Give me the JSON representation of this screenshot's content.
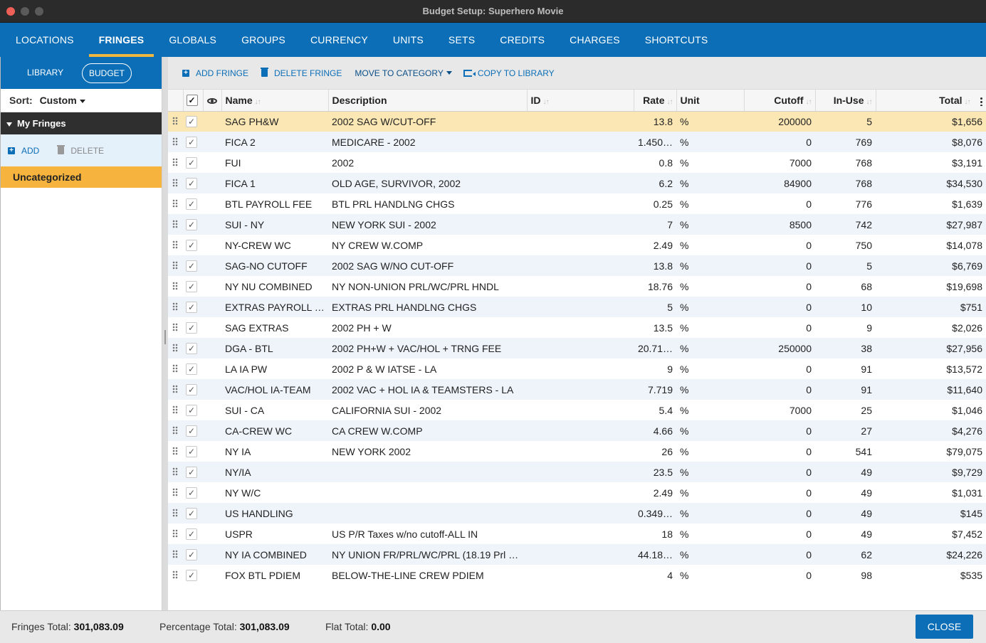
{
  "window": {
    "title": "Budget Setup: Superhero Movie"
  },
  "topnav": {
    "tabs": [
      {
        "label": "LOCATIONS"
      },
      {
        "label": "FRINGES",
        "active": true
      },
      {
        "label": "GLOBALS"
      },
      {
        "label": "GROUPS"
      },
      {
        "label": "CURRENCY"
      },
      {
        "label": "UNITS"
      },
      {
        "label": "SETS"
      },
      {
        "label": "CREDITS"
      },
      {
        "label": "CHARGES"
      },
      {
        "label": "SHORTCUTS"
      }
    ]
  },
  "sidebar": {
    "library_label": "LIBRARY",
    "budget_label": "BUDGET",
    "sort_label": "Sort:",
    "sort_value": "Custom",
    "group_title": "My Fringes",
    "add_label": "ADD",
    "delete_label": "DELETE",
    "category": "Uncategorized"
  },
  "toolbar": {
    "add_fringe": "ADD FRINGE",
    "delete_fringe": "DELETE FRINGE",
    "move_to_category": "MOVE TO CATEGORY",
    "copy_to_library": "COPY TO LIBRARY"
  },
  "table": {
    "headers": {
      "name": "Name",
      "description": "Description",
      "id": "ID",
      "rate": "Rate",
      "unit": "Unit",
      "cutoff": "Cutoff",
      "inuse": "In-Use",
      "total": "Total"
    },
    "rows": [
      {
        "name": "SAG PH&W",
        "description": "2002 SAG W/CUT-OFF",
        "id": "",
        "rate": "13.8",
        "unit": "%",
        "cutoff": "200000",
        "inuse": "5",
        "total": "$1,656"
      },
      {
        "name": "FICA 2",
        "description": "MEDICARE - 2002",
        "id": "",
        "rate": "1.450…",
        "unit": "%",
        "cutoff": "0",
        "inuse": "769",
        "total": "$8,076"
      },
      {
        "name": "FUI",
        "description": "2002",
        "id": "",
        "rate": "0.8",
        "unit": "%",
        "cutoff": "7000",
        "inuse": "768",
        "total": "$3,191"
      },
      {
        "name": "FICA 1",
        "description": "OLD AGE, SURVIVOR, 2002",
        "id": "",
        "rate": "6.2",
        "unit": "%",
        "cutoff": "84900",
        "inuse": "768",
        "total": "$34,530"
      },
      {
        "name": "BTL PAYROLL FEE",
        "description": "BTL PRL HANDLNG CHGS",
        "id": "",
        "rate": "0.25",
        "unit": "%",
        "cutoff": "0",
        "inuse": "776",
        "total": "$1,639"
      },
      {
        "name": "SUI - NY",
        "description": "NEW YORK SUI - 2002",
        "id": "",
        "rate": "7",
        "unit": "%",
        "cutoff": "8500",
        "inuse": "742",
        "total": "$27,987"
      },
      {
        "name": "NY-CREW WC",
        "description": "NY CREW W.COMP",
        "id": "",
        "rate": "2.49",
        "unit": "%",
        "cutoff": "0",
        "inuse": "750",
        "total": "$14,078"
      },
      {
        "name": "SAG-NO CUTOFF",
        "description": "2002 SAG W/NO CUT-OFF",
        "id": "",
        "rate": "13.8",
        "unit": "%",
        "cutoff": "0",
        "inuse": "5",
        "total": "$6,769"
      },
      {
        "name": "NY NU COMBINED",
        "description": "NY NON-UNION PRL/WC/PRL HNDL",
        "id": "",
        "rate": "18.76",
        "unit": "%",
        "cutoff": "0",
        "inuse": "68",
        "total": "$19,698"
      },
      {
        "name": "EXTRAS PAYROLL …",
        "description": "EXTRAS PRL HANDLNG CHGS",
        "id": "",
        "rate": "5",
        "unit": "%",
        "cutoff": "0",
        "inuse": "10",
        "total": "$751"
      },
      {
        "name": "SAG EXTRAS",
        "description": "2002 PH + W",
        "id": "",
        "rate": "13.5",
        "unit": "%",
        "cutoff": "0",
        "inuse": "9",
        "total": "$2,026"
      },
      {
        "name": "DGA - BTL",
        "description": "2002 PH+W + VAC/HOL + TRNG FEE",
        "id": "",
        "rate": "20.71…",
        "unit": "%",
        "cutoff": "250000",
        "inuse": "38",
        "total": "$27,956"
      },
      {
        "name": "LA IA PW",
        "description": "2002 P & W IATSE - LA",
        "id": "",
        "rate": "9",
        "unit": "%",
        "cutoff": "0",
        "inuse": "91",
        "total": "$13,572"
      },
      {
        "name": "VAC/HOL IA-TEAM",
        "description": "2002 VAC + HOL IA & TEAMSTERS - LA",
        "id": "",
        "rate": "7.719",
        "unit": "%",
        "cutoff": "0",
        "inuse": "91",
        "total": "$11,640"
      },
      {
        "name": "SUI - CA",
        "description": "CALIFORNIA SUI - 2002",
        "id": "",
        "rate": "5.4",
        "unit": "%",
        "cutoff": "7000",
        "inuse": "25",
        "total": "$1,046"
      },
      {
        "name": "CA-CREW WC",
        "description": "CA CREW W.COMP",
        "id": "",
        "rate": "4.66",
        "unit": "%",
        "cutoff": "0",
        "inuse": "27",
        "total": "$4,276"
      },
      {
        "name": "NY IA",
        "description": "NEW YORK 2002",
        "id": "",
        "rate": "26",
        "unit": "%",
        "cutoff": "0",
        "inuse": "541",
        "total": "$79,075"
      },
      {
        "name": "NY/IA",
        "description": "",
        "id": "",
        "rate": "23.5",
        "unit": "%",
        "cutoff": "0",
        "inuse": "49",
        "total": "$9,729"
      },
      {
        "name": "NY W/C",
        "description": "",
        "id": "",
        "rate": "2.49",
        "unit": "%",
        "cutoff": "0",
        "inuse": "49",
        "total": "$1,031"
      },
      {
        "name": "US HANDLING",
        "description": "",
        "id": "",
        "rate": "0.349…",
        "unit": "%",
        "cutoff": "0",
        "inuse": "49",
        "total": "$145"
      },
      {
        "name": "USPR",
        "description": "US P/R Taxes w/no cutoff-ALL IN",
        "id": "",
        "rate": "18",
        "unit": "%",
        "cutoff": "0",
        "inuse": "49",
        "total": "$7,452"
      },
      {
        "name": "NY IA COMBINED",
        "description": "NY UNION FR/PRL/WC/PRL (18.19 Prl …",
        "id": "",
        "rate": "44.18…",
        "unit": "%",
        "cutoff": "0",
        "inuse": "62",
        "total": "$24,226"
      },
      {
        "name": "FOX BTL PDIEM",
        "description": "BELOW-THE-LINE CREW PDIEM",
        "id": "",
        "rate": "4",
        "unit": "%",
        "cutoff": "0",
        "inuse": "98",
        "total": "$535"
      }
    ]
  },
  "footer": {
    "fringes_total_label": "Fringes Total:",
    "fringes_total_value": "301,083.09",
    "percentage_total_label": "Percentage Total:",
    "percentage_total_value": "301,083.09",
    "flat_total_label": "Flat Total:",
    "flat_total_value": "0.00",
    "close_label": "CLOSE"
  }
}
